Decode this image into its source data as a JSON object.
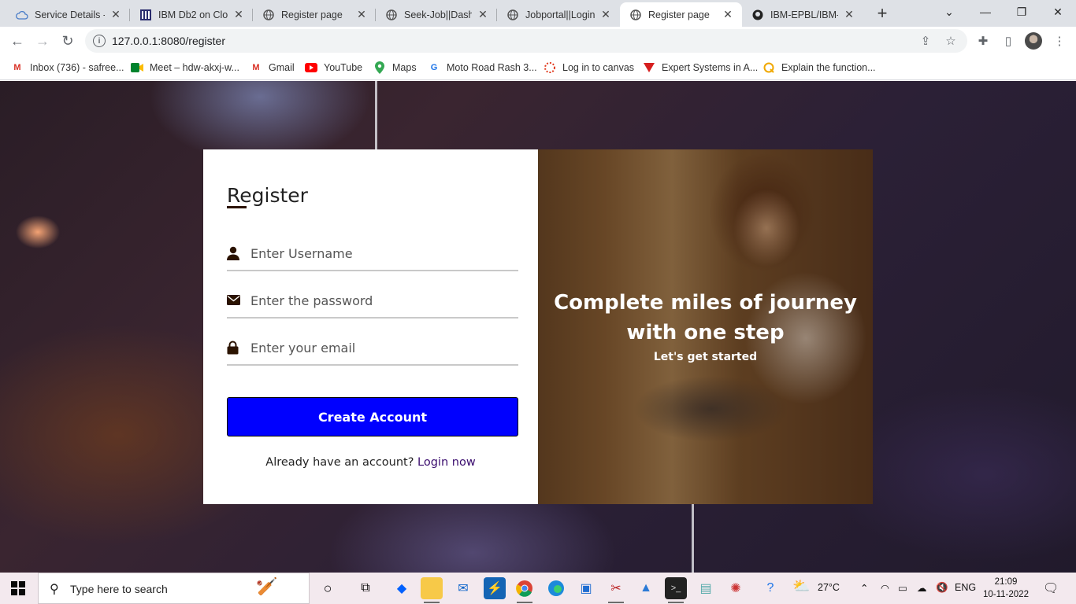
{
  "browser": {
    "tabs": [
      {
        "title": "Service Details - I",
        "active": false
      },
      {
        "title": "IBM Db2 on Clou",
        "active": false
      },
      {
        "title": "Register page",
        "active": false
      },
      {
        "title": "Seek-Job||Dashb",
        "active": false
      },
      {
        "title": "Jobportal||Login",
        "active": false
      },
      {
        "title": "Register page",
        "active": true
      },
      {
        "title": "IBM-EPBL/IBM-Pr",
        "active": false
      }
    ],
    "url": "127.0.0.1:8080/register",
    "bookmarks": [
      {
        "label": "Inbox (736) - safree..."
      },
      {
        "label": "Meet – hdw-akxj-w..."
      },
      {
        "label": "Gmail"
      },
      {
        "label": "YouTube"
      },
      {
        "label": "Maps"
      },
      {
        "label": "Moto Road Rash 3..."
      },
      {
        "label": "Log in to canvas"
      },
      {
        "label": "Expert Systems in A..."
      },
      {
        "label": "Explain the function..."
      }
    ]
  },
  "page": {
    "form": {
      "title": "Register",
      "username_placeholder": "Enter Username",
      "password_placeholder": "Enter the password",
      "email_placeholder": "Enter your email",
      "submit_label": "Create Account",
      "login_prompt": "Already have an account?",
      "login_link": "Login now"
    },
    "hero": {
      "headline_line1": "Complete miles of journey",
      "headline_line2": "with one step",
      "subline": "Let's get started"
    },
    "colors": {
      "button": "#0000ff",
      "link": "#3a0c6e",
      "icon": "#2b1300"
    }
  },
  "taskbar": {
    "search_placeholder": "Type here to search",
    "weather": "27°C",
    "language": "ENG",
    "time": "21:09",
    "date": "10-11-2022"
  }
}
